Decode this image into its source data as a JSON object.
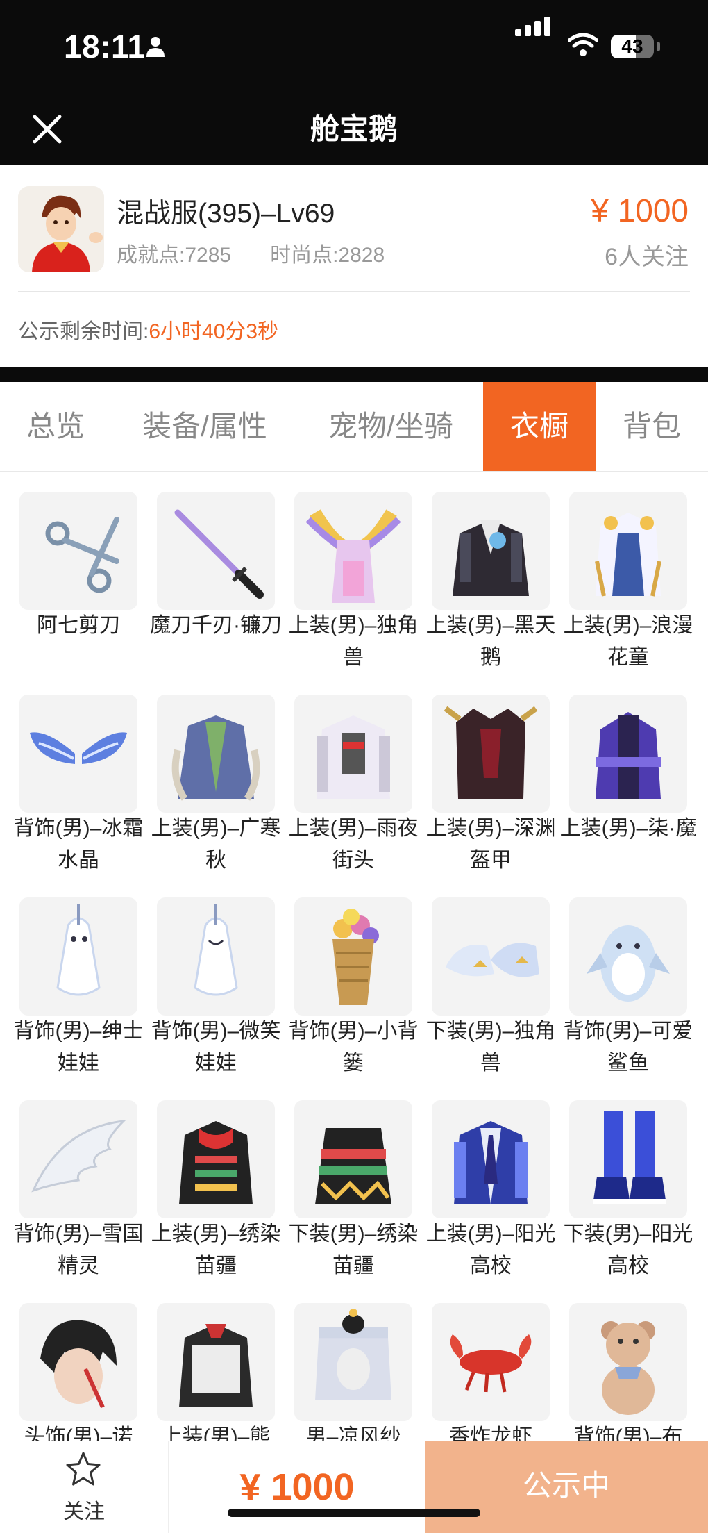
{
  "status_bar": {
    "time": "18:11",
    "battery": "43"
  },
  "nav": {
    "title": "舱宝鹅"
  },
  "listing": {
    "name": "混战服(395)–Lv69",
    "achievement": "成就点:7285",
    "fashion": "时尚点:2828",
    "price": "¥ 1000",
    "watchers": "6人关注",
    "remain_label": "公示剩余时间:",
    "remain_value": "6小时40分3秒"
  },
  "tabs": [
    {
      "label": "总览",
      "active": false
    },
    {
      "label": "装备/属性",
      "active": false
    },
    {
      "label": "宠物/坐骑",
      "active": false
    },
    {
      "label": "衣橱",
      "active": true
    },
    {
      "label": "背包",
      "active": false
    }
  ],
  "items": [
    {
      "label": "阿七剪刀",
      "icon": "scissors-icon"
    },
    {
      "label": "魔刀千刃·镰刀",
      "icon": "sword-icon"
    },
    {
      "label": "上装(男)–独角兽",
      "icon": "unicorn-top-icon"
    },
    {
      "label": "上装(男)–黑天鹅",
      "icon": "black-swan-top-icon"
    },
    {
      "label": "上装(男)–浪漫花童",
      "icon": "flower-boy-top-icon"
    },
    {
      "label": "背饰(男)–冰霜水晶",
      "icon": "ice-wings-icon"
    },
    {
      "label": "上装(男)–广寒秋",
      "icon": "robe-top-icon"
    },
    {
      "label": "上装(男)–雨夜街头",
      "icon": "street-jacket-icon"
    },
    {
      "label": "上装(男)–深渊盔甲",
      "icon": "abyss-armor-icon"
    },
    {
      "label": "上装(男)–柒·魔",
      "icon": "purple-hoodie-icon"
    },
    {
      "label": "背饰(男)–绅士娃娃",
      "icon": "ghost-doll-icon"
    },
    {
      "label": "背饰(男)–微笑娃娃",
      "icon": "smile-doll-icon"
    },
    {
      "label": "背饰(男)–小背篓",
      "icon": "flower-basket-icon"
    },
    {
      "label": "下装(男)–独角兽",
      "icon": "unicorn-shoes-icon"
    },
    {
      "label": "背饰(男)–可爱鲨鱼",
      "icon": "shark-icon"
    },
    {
      "label": "背饰(男)–雪国精灵",
      "icon": "white-wing-icon"
    },
    {
      "label": "上装(男)–绣染苗疆",
      "icon": "miao-top-icon"
    },
    {
      "label": "下装(男)–绣染苗疆",
      "icon": "miao-skirt-icon"
    },
    {
      "label": "上装(男)–阳光高校",
      "icon": "school-top-icon"
    },
    {
      "label": "下装(男)–阳光高校",
      "icon": "school-shoes-icon"
    },
    {
      "label": "头饰(男)–诺",
      "icon": "hair-icon"
    },
    {
      "label": "上装(男)–熊",
      "icon": "bear-jacket-icon"
    },
    {
      "label": "男–凉风纱",
      "icon": "veil-hat-icon"
    },
    {
      "label": "香炸龙虾",
      "icon": "lobster-icon"
    },
    {
      "label": "背饰(男)–布",
      "icon": "teddy-bear-icon"
    }
  ],
  "bottom": {
    "follow_label": "关注",
    "price": "¥ 1000",
    "status": "公示中"
  }
}
